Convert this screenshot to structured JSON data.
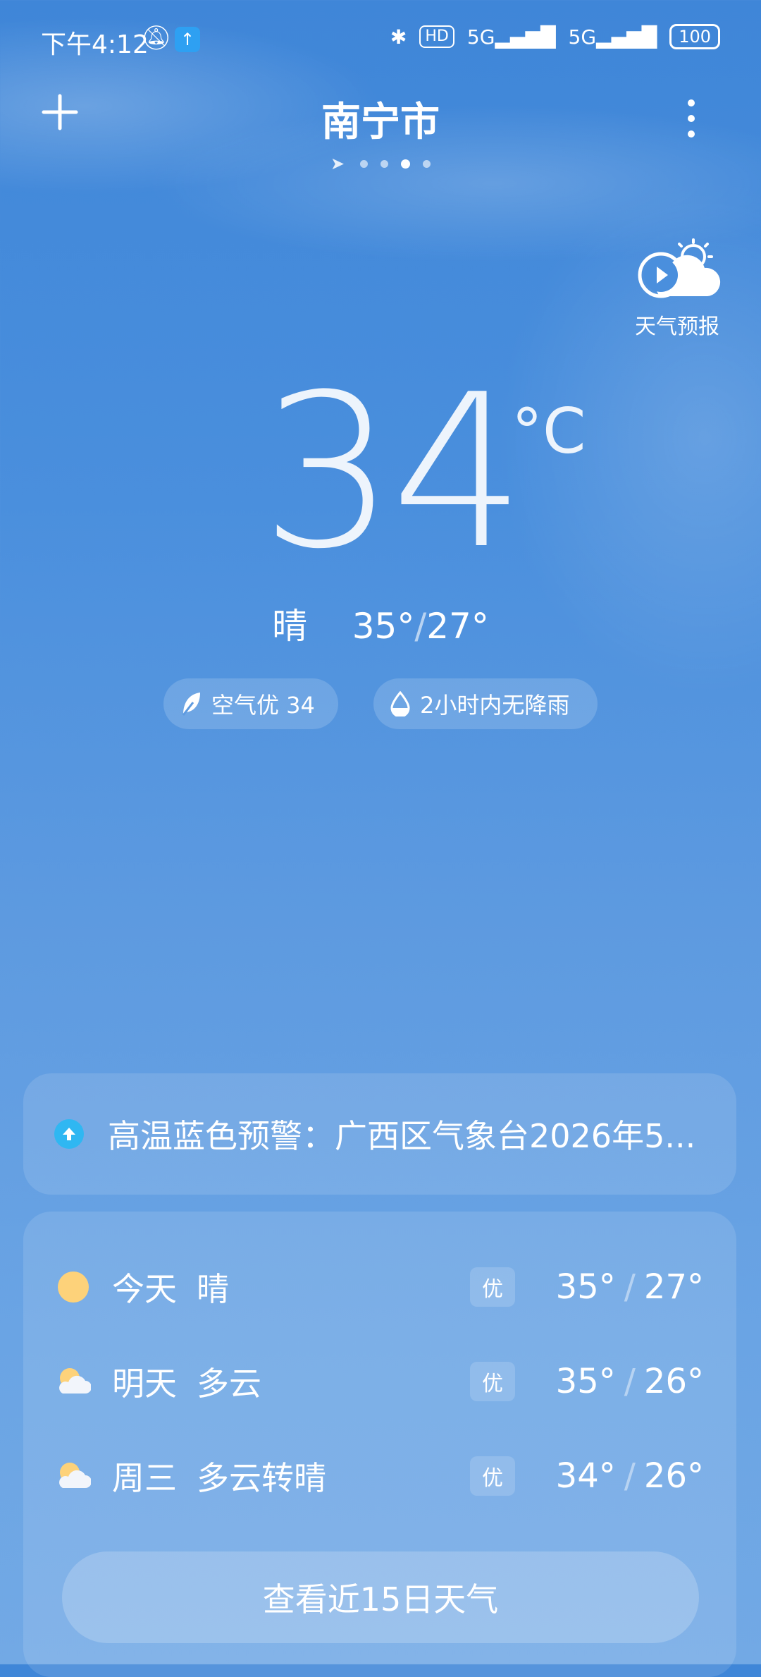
{
  "status_bar": {
    "time": "下午4:12",
    "hd_badge": "HD",
    "signal1": "5G",
    "signal2": "5G",
    "battery": "100"
  },
  "header": {
    "city": "南宁市",
    "page_count": 4,
    "active_page": 3
  },
  "video_forecast": {
    "label": "天气预报"
  },
  "current": {
    "temperature": "34",
    "unit": "°C",
    "condition": "晴",
    "high": "35°",
    "low": "27°"
  },
  "chips": {
    "air": "空气优 34",
    "rain": "2小时内无降雨"
  },
  "alert": {
    "text": "高温蓝色预警：广西区气象台2026年5..."
  },
  "forecast": [
    {
      "day": "今天",
      "condition": "晴",
      "icon": "sun-icon",
      "aqi": "优",
      "high": "35°",
      "low": "27°"
    },
    {
      "day": "明天",
      "condition": "多云",
      "icon": "partly-cloudy-icon",
      "aqi": "优",
      "high": "35°",
      "low": "26°"
    },
    {
      "day": "周三",
      "condition": "多云转晴",
      "icon": "partly-cloudy-icon",
      "aqi": "优",
      "high": "34°",
      "low": "26°"
    }
  ],
  "forecast_separator": "/",
  "temp_separator": "/",
  "view_15_days": "查看近15日天气",
  "colors": {
    "alert_icon": "#2fb7f2",
    "sun": "#fdd27a",
    "upload_badge": "#2ea0f2"
  }
}
